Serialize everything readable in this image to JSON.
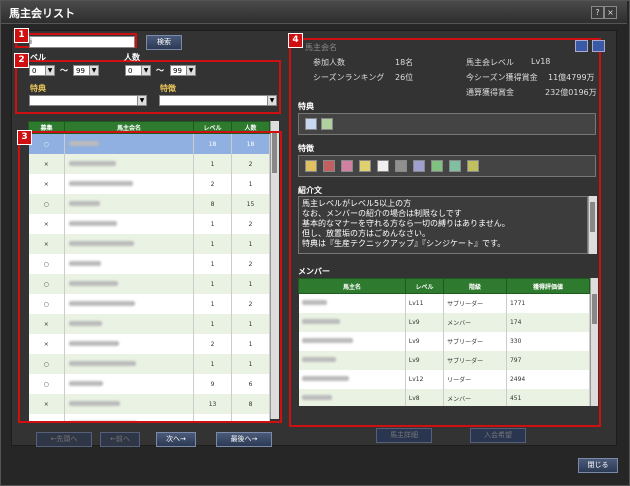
{
  "window": {
    "title": "馬主会リスト",
    "help": "?",
    "close": "×"
  },
  "badges": [
    "1",
    "2",
    "3",
    "4"
  ],
  "search": {
    "value": "i",
    "button": "検索"
  },
  "filters": {
    "level_label": "ベル",
    "member_label": "人数",
    "level_min": "0",
    "level_max": "99",
    "member_min": "0",
    "member_max": "99",
    "tilde": "〜",
    "perk_label": "特典",
    "trait_label": "特徴",
    "perk_value": "",
    "trait_value": ""
  },
  "list": {
    "headers": [
      "募集",
      "馬主会名",
      "レベル",
      "人数"
    ],
    "rows": [
      {
        "recruit": "○",
        "level": "18",
        "members": "18"
      },
      {
        "recruit": "×",
        "level": "1",
        "members": "2"
      },
      {
        "recruit": "×",
        "level": "2",
        "members": "1"
      },
      {
        "recruit": "○",
        "level": "8",
        "members": "15"
      },
      {
        "recruit": "×",
        "level": "1",
        "members": "2"
      },
      {
        "recruit": "×",
        "level": "1",
        "members": "1"
      },
      {
        "recruit": "○",
        "level": "1",
        "members": "2"
      },
      {
        "recruit": "○",
        "level": "1",
        "members": "1"
      },
      {
        "recruit": "○",
        "level": "1",
        "members": "2"
      },
      {
        "recruit": "×",
        "level": "1",
        "members": "1"
      },
      {
        "recruit": "×",
        "level": "2",
        "members": "1"
      },
      {
        "recruit": "○",
        "level": "1",
        "members": "1"
      },
      {
        "recruit": "○",
        "level": "9",
        "members": "6"
      },
      {
        "recruit": "×",
        "level": "13",
        "members": "8"
      },
      {
        "recruit": "×",
        "level": "1",
        "members": "1"
      }
    ]
  },
  "pager": {
    "first": "←先頭へ",
    "prev": "←前へ",
    "next": "次へ→",
    "last": "最後へ→"
  },
  "detail": {
    "club_name": "馬主会名",
    "stats": [
      {
        "label": "参加人数",
        "value": "18名"
      },
      {
        "label": "シーズンランキング",
        "value": "26位"
      },
      {
        "label": "馬主会レベル",
        "value": "Lv18"
      },
      {
        "label": "今シーズン獲得賞金",
        "value": "11億4799万"
      },
      {
        "label": "通算獲得賞金",
        "value": "232億0196万"
      }
    ],
    "perk_title": "特典",
    "trait_title": "特徴",
    "intro_title": "紹介文",
    "intro_lines": [
      "馬主レベルがレベル5以上の方",
      "なお、メンバーの紹介の場合は制限なしです",
      "基本的なマナーを守れる方なら一切の縛りはありません。",
      "但し、放置垢の方はごめんなさい。",
      "特典は『生産テクニックアップ』『シンジケート』です。"
    ],
    "member_title": "メンバー",
    "member_headers": [
      "馬主名",
      "レベル",
      "階級",
      "獲得評価値"
    ],
    "members": [
      {
        "level": "Lv11",
        "rank": "サブリーダー",
        "value": "1771"
      },
      {
        "level": "Lv9",
        "rank": "メンバー",
        "value": "174"
      },
      {
        "level": "Lv9",
        "rank": "サブリーダー",
        "value": "330"
      },
      {
        "level": "Lv9",
        "rank": "サブリーダー",
        "value": "797"
      },
      {
        "level": "Lv12",
        "rank": "リーダー",
        "value": "2494"
      },
      {
        "level": "Lv8",
        "rank": "メンバー",
        "value": "451"
      }
    ],
    "owner_detail": "馬主詳細",
    "join_request": "入会希望"
  },
  "close_button": "閉じる"
}
